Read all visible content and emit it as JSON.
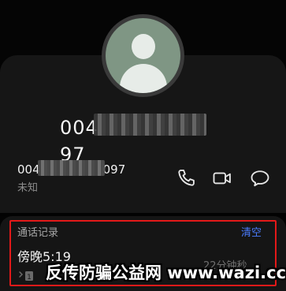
{
  "contact": {
    "number_prefix": "004",
    "number_suffix": "97",
    "row_number_prefix": "004",
    "row_number_suffix": "097",
    "location": "未知"
  },
  "actions": [
    {
      "icon": "phone-icon"
    },
    {
      "icon": "video-call-icon"
    },
    {
      "icon": "message-icon"
    }
  ],
  "history": {
    "title": "通话记录",
    "clear_label": "清空",
    "entries": [
      {
        "time": "傍晚5:19",
        "duration": "22分钟秒",
        "sim": "1"
      }
    ]
  },
  "watermark": "反传防骗公益网 www.wazi.cc",
  "colors": {
    "background": "#030303",
    "card": "#161616",
    "accent_blue": "#4a7cff",
    "highlight_red": "#e31919"
  }
}
